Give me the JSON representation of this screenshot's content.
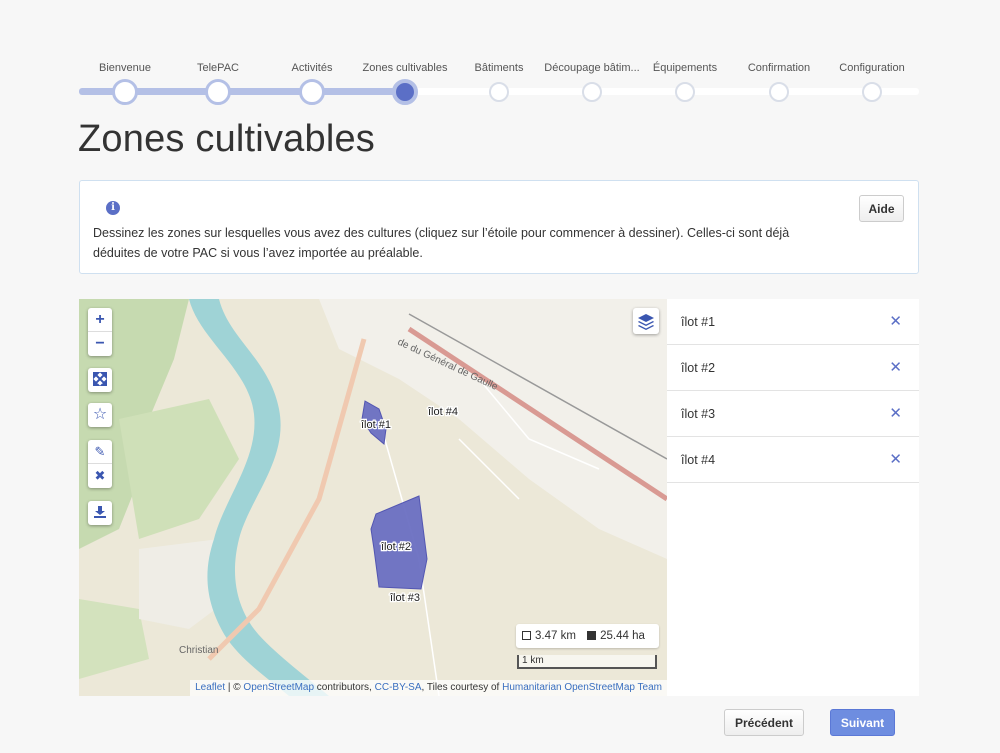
{
  "stepper": {
    "steps": [
      {
        "label": "Bienvenue",
        "state": "done"
      },
      {
        "label": "TelePAC",
        "state": "done"
      },
      {
        "label": "Activités",
        "state": "done"
      },
      {
        "label": "Zones cultivables",
        "state": "active"
      },
      {
        "label": "Bâtiments",
        "state": "todo"
      },
      {
        "label": "Découpage bâtim...",
        "state": "todo"
      },
      {
        "label": "Équipements",
        "state": "todo"
      },
      {
        "label": "Confirmation",
        "state": "todo"
      },
      {
        "label": "Configuration",
        "state": "todo"
      }
    ]
  },
  "page": {
    "title": "Zones cultivables"
  },
  "info": {
    "icon": "info-icon",
    "text": "Dessinez les zones sur lesquelles vous avez des cultures (cliquez sur l’étoile pour commencer à dessiner). Celles-ci sont déjà déduites de votre PAC si vous l’avez importée au préalable.",
    "help_label": "Aide"
  },
  "map": {
    "controls": {
      "zoom_in": "+",
      "zoom_out": "−"
    },
    "labels": {
      "road": "de du Général de Gaulle",
      "town": "Christian",
      "plot1": "îlot #1",
      "plot2": "îlot #2",
      "plot3": "îlot #3",
      "plot4": "îlot #4"
    },
    "measure": {
      "perimeter": "3.47 km",
      "area": "25.44 ha"
    },
    "scale": "1 km",
    "attribution": {
      "leaflet": "Leaflet",
      "sep1": " | © ",
      "osm": "OpenStreetMap",
      "contributors": " contributors, ",
      "license": "CC-BY-SA",
      "tiles": ", Tiles courtesy of ",
      "hot": "Humanitarian OpenStreetMap Team"
    },
    "colors": {
      "water": "#9fd3d6",
      "forest": "#c6dab0",
      "plot": "#6b6fc2"
    }
  },
  "plots": [
    {
      "label": "îlot #1"
    },
    {
      "label": "îlot #2"
    },
    {
      "label": "îlot #3"
    },
    {
      "label": "îlot #4"
    }
  ],
  "footer": {
    "prev_label": "Précédent",
    "next_label": "Suivant"
  }
}
